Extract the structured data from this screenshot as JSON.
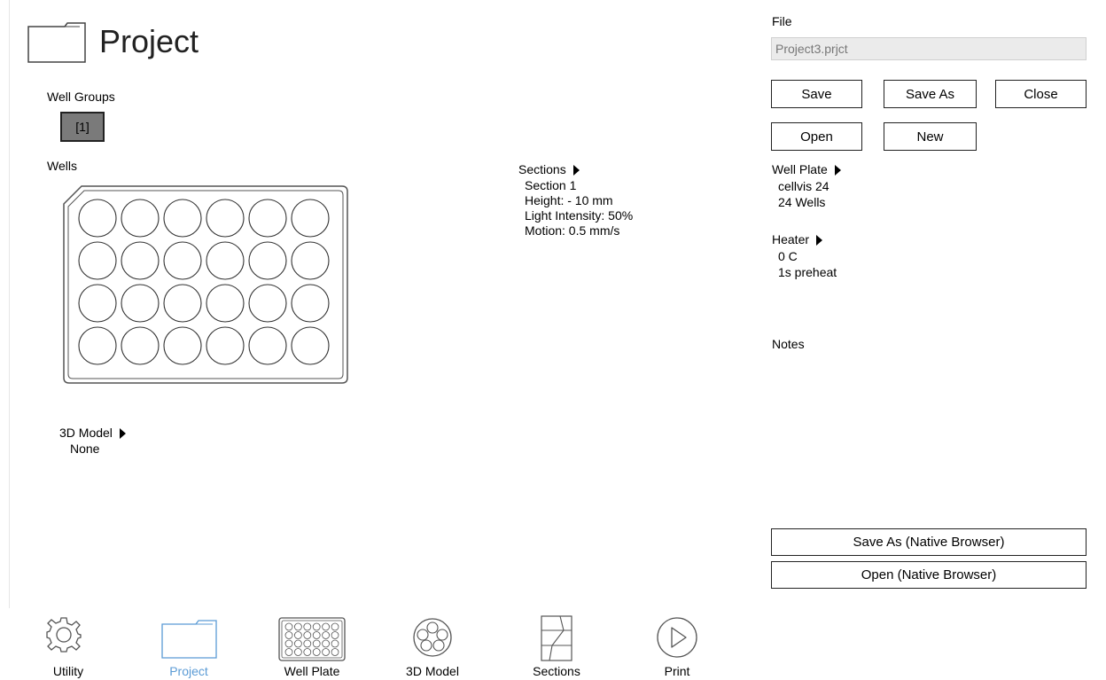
{
  "header": {
    "title": "Project"
  },
  "left": {
    "well_groups_label": "Well Groups",
    "group_button": "[1]",
    "wells_label": "Wells",
    "model": {
      "label": "3D Model",
      "value": "None"
    }
  },
  "sections": {
    "label": "Sections",
    "lines": [
      "Section 1",
      "Height:  - 10 mm",
      "Light Intensity: 50%",
      "Motion: 0.5 mm/s"
    ]
  },
  "file": {
    "label": "File",
    "filename": "Project3.prjct",
    "buttons": {
      "save": "Save",
      "save_as": "Save As",
      "close": "Close",
      "open": "Open",
      "new": "New"
    }
  },
  "well_plate": {
    "label": "Well Plate",
    "name": "cellvis 24",
    "wells": "24 Wells"
  },
  "heater": {
    "label": "Heater",
    "temp": "0 C",
    "preheat": "1s preheat"
  },
  "notes": {
    "label": "Notes"
  },
  "native": {
    "save_as": "Save As (Native Browser)",
    "open": "Open (Native Browser)"
  },
  "nav": [
    {
      "label": "Utility",
      "icon": "gear-icon"
    },
    {
      "label": "Project",
      "icon": "folder-icon",
      "active": true
    },
    {
      "label": "Well Plate",
      "icon": "well-plate-icon"
    },
    {
      "label": "3D Model",
      "icon": "model-icon"
    },
    {
      "label": "Sections",
      "icon": "sections-icon"
    },
    {
      "label": "Print",
      "icon": "play-icon"
    }
  ],
  "colors": {
    "active_nav": "#5b9bd5",
    "group_button_bg": "#7a7a7a"
  }
}
